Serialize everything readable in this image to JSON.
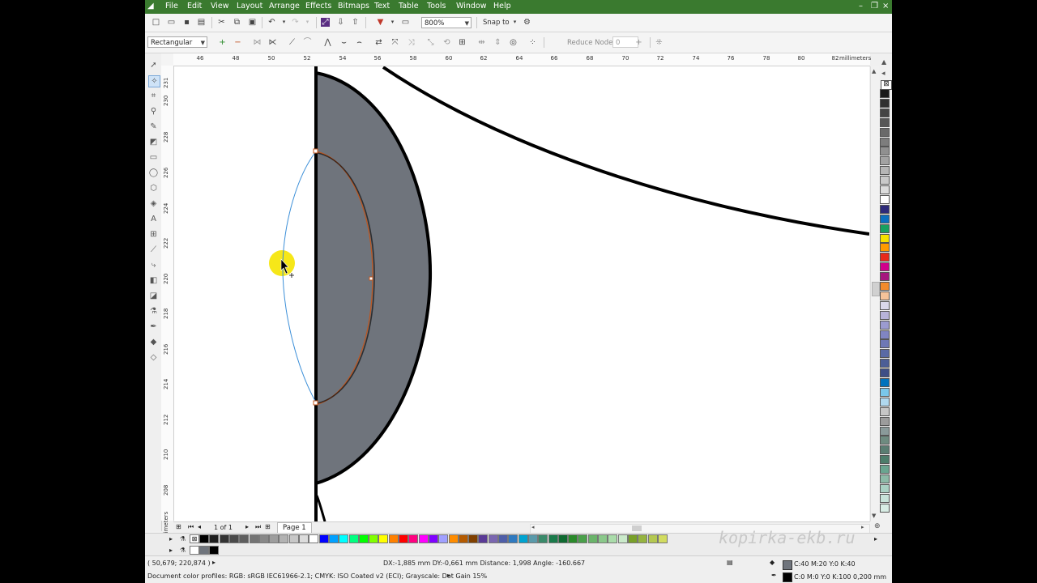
{
  "menu": [
    "File",
    "Edit",
    "View",
    "Layout",
    "Arrange",
    "Effects",
    "Bitmaps",
    "Text",
    "Table",
    "Tools",
    "Window",
    "Help"
  ],
  "standard_toolbar": {
    "zoom_value": "800%",
    "snap_label": "Snap to"
  },
  "property_bar": {
    "mode_value": "Rectangular",
    "reduce_nodes_label": "Reduce Nodes",
    "reduce_nodes_value": "0"
  },
  "ruler": {
    "h_ticks": [
      "46",
      "48",
      "50",
      "52",
      "54",
      "56",
      "58",
      "60",
      "62",
      "64",
      "66",
      "68",
      "70",
      "72",
      "74",
      "76",
      "78",
      "80",
      "82"
    ],
    "v_ticks": [
      "231",
      "230",
      "228",
      "226",
      "224",
      "222",
      "220",
      "218",
      "216",
      "214",
      "212",
      "210",
      "208"
    ],
    "units": "millimeters",
    "v_units": "millimeters"
  },
  "page_nav": {
    "counter": "1 of 1",
    "tab": "Page 1"
  },
  "status": {
    "coords": "( 50,679; 220,874 )",
    "measure": "DX:-1,885 mm DY:-0,661 mm Distance: 1,998 Angle: -160.667",
    "profiles": "Document color profiles: RGB: sRGB IEC61966-2.1; CMYK: ISO Coated v2 (ECI); Grayscale: Dot Gain 15%",
    "fill_info": "C:40 M:20 Y:0 K:40",
    "outline_info": "C:0 M:0 Y:0 K:100  0,200 mm"
  },
  "watermark": "kopirka-ekb.ru",
  "colors": {
    "menubar": "#3a7a2f",
    "shape_fill": "#6f747c",
    "cursor_highlight": "#f5e400",
    "selected_node_path": "#3c8fd8",
    "inner_curve": "#c0561e"
  },
  "palette_colors": [
    "#1a1a1a",
    "#303030",
    "#444444",
    "#575757",
    "#6a6a6a",
    "#7d7d7d",
    "#909090",
    "#a3a3a3",
    "#b6b6b6",
    "#c9c9c9",
    "#dcdcdc",
    "#ffffff",
    "#2d2a7a",
    "#0b6fbf",
    "#17a060",
    "#f5e000",
    "#ff9a00",
    "#e82a1c",
    "#d1008b",
    "#a6177e",
    "#f28b2c",
    "#f5c39a",
    "#dad8eb",
    "#b7b3d9",
    "#9b9bd0",
    "#8085c2",
    "#6e78b5",
    "#5a6aa5",
    "#4c5e96",
    "#3e4f86",
    "#0072bc",
    "#7ac7ea",
    "#b0d8ee",
    "#c6c6c6",
    "#9c9c9c",
    "#8a9a9a",
    "#6e8b80",
    "#5a7d72",
    "#4d7d6b",
    "#6aa590",
    "#8cbaa7",
    "#a9d1c3",
    "#c7e3d9",
    "#d8ede5"
  ],
  "doc_palette": [
    "#000000",
    "#1e1e1e",
    "#333333",
    "#4a4a4a",
    "#5e5e5e",
    "#737373",
    "#888888",
    "#9d9d9d",
    "#b2b2b2",
    "#c7c7c7",
    "#dcdcdc",
    "#ffffff",
    "#0000ff",
    "#00a0ff",
    "#00ffff",
    "#00ff80",
    "#00ff00",
    "#80ff00",
    "#ffff00",
    "#ff8000",
    "#ff0000",
    "#ff0080",
    "#ff00ff",
    "#8000ff",
    "#a0a0ff",
    "#ff8c00",
    "#b45a00",
    "#804000",
    "#5a3a96",
    "#7a66b0",
    "#4e5ea8",
    "#2f7ac0",
    "#00a3d0",
    "#5a9aaa",
    "#3a8a6a",
    "#1a7a4a",
    "#0f6a30",
    "#2a8a2a",
    "#4aa04a",
    "#6ab46a",
    "#8ac88a",
    "#aadcaa",
    "#caeaca",
    "#78a028",
    "#96b440",
    "#b4c850",
    "#d2dc60"
  ],
  "doc_palette2": [
    "#ffffff",
    "#6f747c",
    "#000000"
  ]
}
